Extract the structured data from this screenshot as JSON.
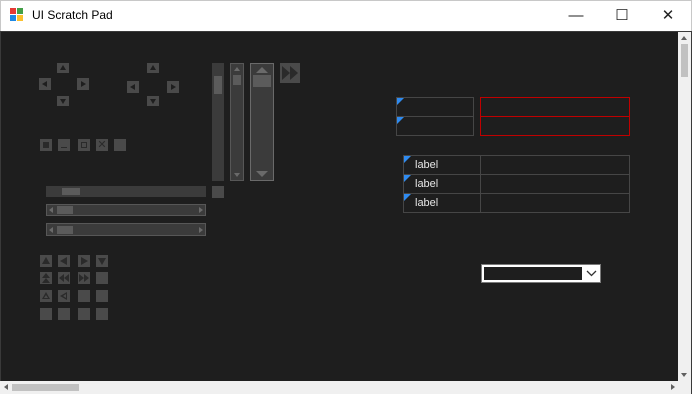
{
  "window": {
    "title": "UI Scratch Pad"
  },
  "caption_buttons": {
    "minimize": "—",
    "maximize": "☐",
    "close": "✕"
  },
  "grid": {
    "labels": [
      "label",
      "label",
      "label"
    ]
  },
  "dropdown": {
    "selected": ""
  },
  "colors": {
    "accent": "#2f8bf0",
    "error": "#c00000",
    "background": "#1e1e1e",
    "control": "#4a4a4a"
  }
}
